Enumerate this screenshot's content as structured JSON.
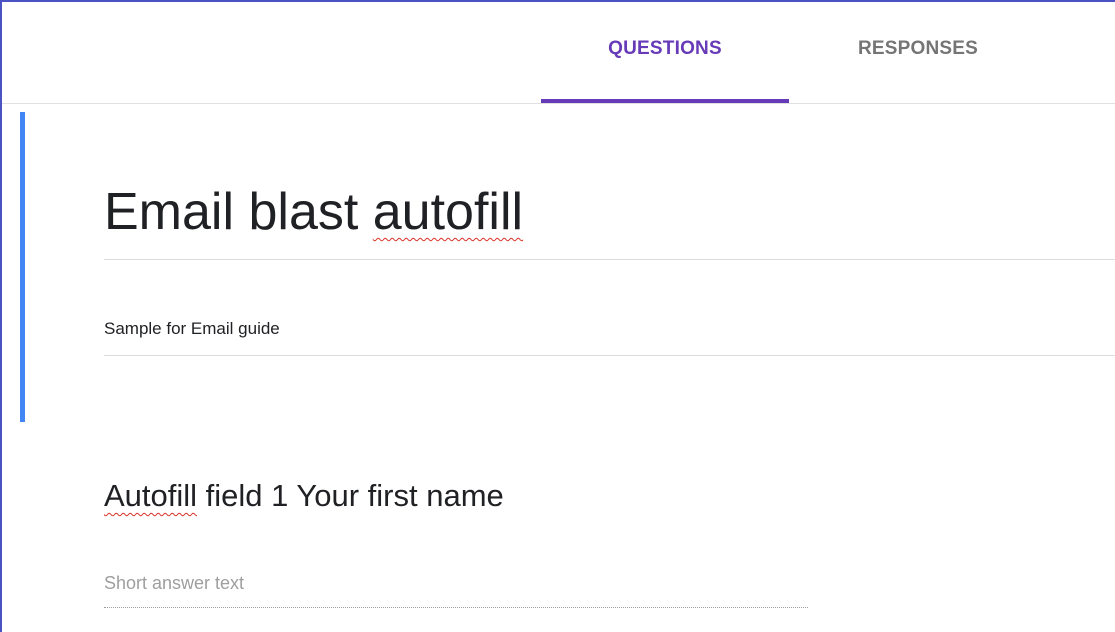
{
  "tabs": {
    "questions_label": "QUESTIONS",
    "responses_label": "RESPONSES"
  },
  "form": {
    "title_part1": "Email blast ",
    "title_part2": "autofill",
    "description": "Sample for Email guide"
  },
  "question": {
    "title_part1": "Autofill",
    "title_part2": " field 1 Your first name",
    "answer_placeholder": "Short answer text"
  },
  "colors": {
    "accent": "#673ab7",
    "inactive_tab": "#757575",
    "left_accent": "#4285f4",
    "spellcheck": "#d93025"
  }
}
